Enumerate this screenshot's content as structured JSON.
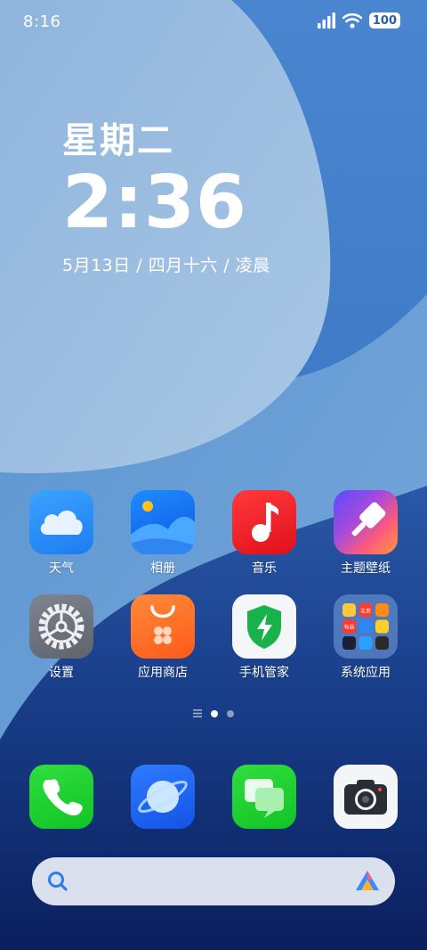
{
  "status_bar": {
    "time": "8:16",
    "battery": "100"
  },
  "clock_widget": {
    "weekday": "星期二",
    "time": "2:36",
    "date_line": "5月13日 / 四月十六  / 凌晨"
  },
  "apps": [
    {
      "label": "天气",
      "icon": "weather-icon"
    },
    {
      "label": "相册",
      "icon": "gallery-icon"
    },
    {
      "label": "音乐",
      "icon": "music-icon"
    },
    {
      "label": "主题壁纸",
      "icon": "themes-icon"
    },
    {
      "label": "设置",
      "icon": "settings-icon"
    },
    {
      "label": "应用商店",
      "icon": "app-store-icon"
    },
    {
      "label": "手机管家",
      "icon": "security-icon"
    },
    {
      "label": "系统应用",
      "icon": "folder-icon"
    }
  ],
  "folder_mini_labels": {
    "top_middle": "北京",
    "mid_left": "有品"
  },
  "page_indicator": {
    "pages": 2,
    "current": 1
  },
  "dock": [
    {
      "icon": "phone-icon"
    },
    {
      "icon": "browser-icon"
    },
    {
      "icon": "messages-icon"
    },
    {
      "icon": "camera-icon"
    }
  ],
  "search": {
    "icon": "search-icon",
    "assistant_icon": "ai-assistant-icon"
  },
  "colors": {
    "wallpaper_light": "#4f8fd6",
    "wallpaper_deep": "#0d2a6b",
    "search_bar": "#ebf0f8"
  }
}
